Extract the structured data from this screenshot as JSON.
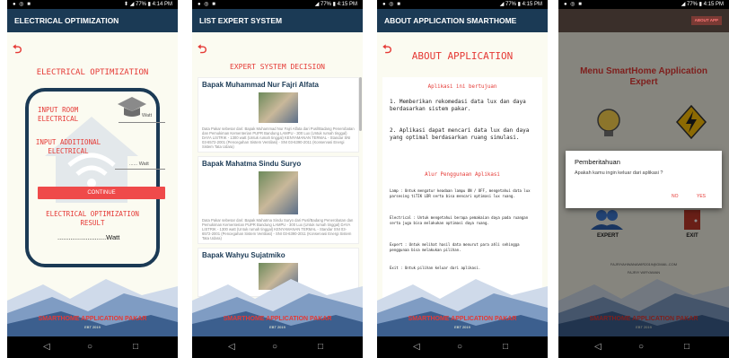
{
  "status": {
    "p1": {
      "left": "● ◎ ■",
      "right": "⬍ ◢ 77% ▮ 4:14 PM"
    },
    "p2": {
      "left": "● ◎ ■",
      "right": "◢ 77% ▮ 4:15 PM"
    },
    "p3": {
      "left": "● ◎ ■",
      "right": "◢ 77% ▮ 4:15 PM"
    },
    "p4": {
      "left": "● ◎ ■",
      "right": "◢ 77% ▮ 4:15 PM"
    }
  },
  "screen1": {
    "title": "ELECTRICAL OPTIMIZATION",
    "heading": "ELECTRICAL OPTIMIZATION",
    "input_room_label": "INPUT ROOM\nELECTRICAL",
    "input_room_unit": "Watt",
    "input_additional_label": "INPUT ADDITIONAL\nELECTRICAL",
    "input_additional_unit": "...... Watt",
    "continue_label": "CONTINUE",
    "result_label": "ELECTRICAL OPTIMIZATION\nRESULT",
    "result_value": "..........................Watt",
    "footer": "SMARTHOME APPLICATION PAKAR",
    "footer_sub": "EBT 2019"
  },
  "screen2": {
    "title": "LIST EXPERT SYSTEM",
    "heading": "EXPERT SYSTEM DECISION",
    "experts": [
      {
        "name": "Bapak Muhammad Nur Fajri Alfata",
        "desc": "Data Pakar sebesar dari: Bapak Muhammad Nur Fajri Alfata dari Pusl/Badang Penerobatan dan Pemukiman Kementerian PUPR Bandung LAMPU - 300 Lux (Untuk rumah tinggal) DAYA LISTRIK - 1300 watt (Untuk rumah tinggal) KENYAMANAN TERMAL - Standar SNI 03-6572-2001 (Pencegahan Sistem Ventilasi) - SNI 03-6390-2011 (Konservasi Energi Sistem Tata Udara)"
      },
      {
        "name": "Bapak Mahatma Sindu Suryo",
        "desc": "Data Pakar sebesar dari: Bapak Mahatma Sindu Suryo dari Pusl/Badang Penerobatan dan Pemukiman Kementerian PUPR Bandung LAMPU - 300 Lux (Untuk rumah tinggal) DAYA LISTRIK - 1300 watt (Untuk rumah tinggal) KENYAMANAN TERMAL - Standar SNI 03-6572-2001 (Pencegahan Sistem Ventilasi) - SNI 03-6390-2011 (Konservasi Energi Sistem Tata Udara)"
      },
      {
        "name": "Bapak Wahyu Sujatmiko",
        "desc": ""
      }
    ],
    "footer": "SMARTHOME APPLICATION PAKAR",
    "footer_sub": "EBT 2019"
  },
  "screen3": {
    "title": "ABOUT APPLICATION SMARTHOME",
    "heading": "ABOUT APPLICATION",
    "purpose_title": "Aplikasi ini bertujuan",
    "purpose_1": "1. Memberikan rekomedasi data lux dan daya berdasarkan sistem pakar.",
    "purpose_2": "2. Aplikasi dapat mencari data lux dan daya yang optimal berdasarkan ruang simulasi.",
    "flow_title": "Alur Penggunaan Aplikasi",
    "flow_1": "Lamp : Untuk mengatur keadaan lampu ON / OFF, mengetahui data lux parsesing tiTIK LDR serta bisa mencari optimasi lux ruang.",
    "flow_2": "Electrical : Untuk mengetahui berapa pemakaian daya pada ruangan serta juga bisa melakukan optimasi daya ruang.",
    "flow_3": "Expert : Untuk melihat hasil data menurut para ahli sehingga penggunaa bisa melakukan pilihan.",
    "flow_4": "Exit : Untuk pilihan keluar dari aplikasi.",
    "footer": "SMARTHOME APPLICATION PAKAR",
    "footer_sub": "EBT 2019"
  },
  "screen4": {
    "about_button": "ABOUT APP",
    "heading": "Menu SmartHome Application Expert",
    "expert_label": "EXPERT",
    "exit_label": "EXIT",
    "dialog_title": "Pemberitahuan",
    "dialog_message": "Apakah kamu ingin keluar dari aplikasi ?",
    "dialog_no": "NO",
    "dialog_yes": "YES",
    "email": "FAJRIYAHWANAWIR2019@GMAIL.COM",
    "author": "FAJRIY WIRYAWAN",
    "footer": "SMARTHOME APPLICATION PAKAR",
    "footer_sub": "EBT 2019"
  },
  "colors": {
    "appbar": "#1b3a55",
    "accent": "#e53935",
    "background": "#fbfbf1"
  }
}
